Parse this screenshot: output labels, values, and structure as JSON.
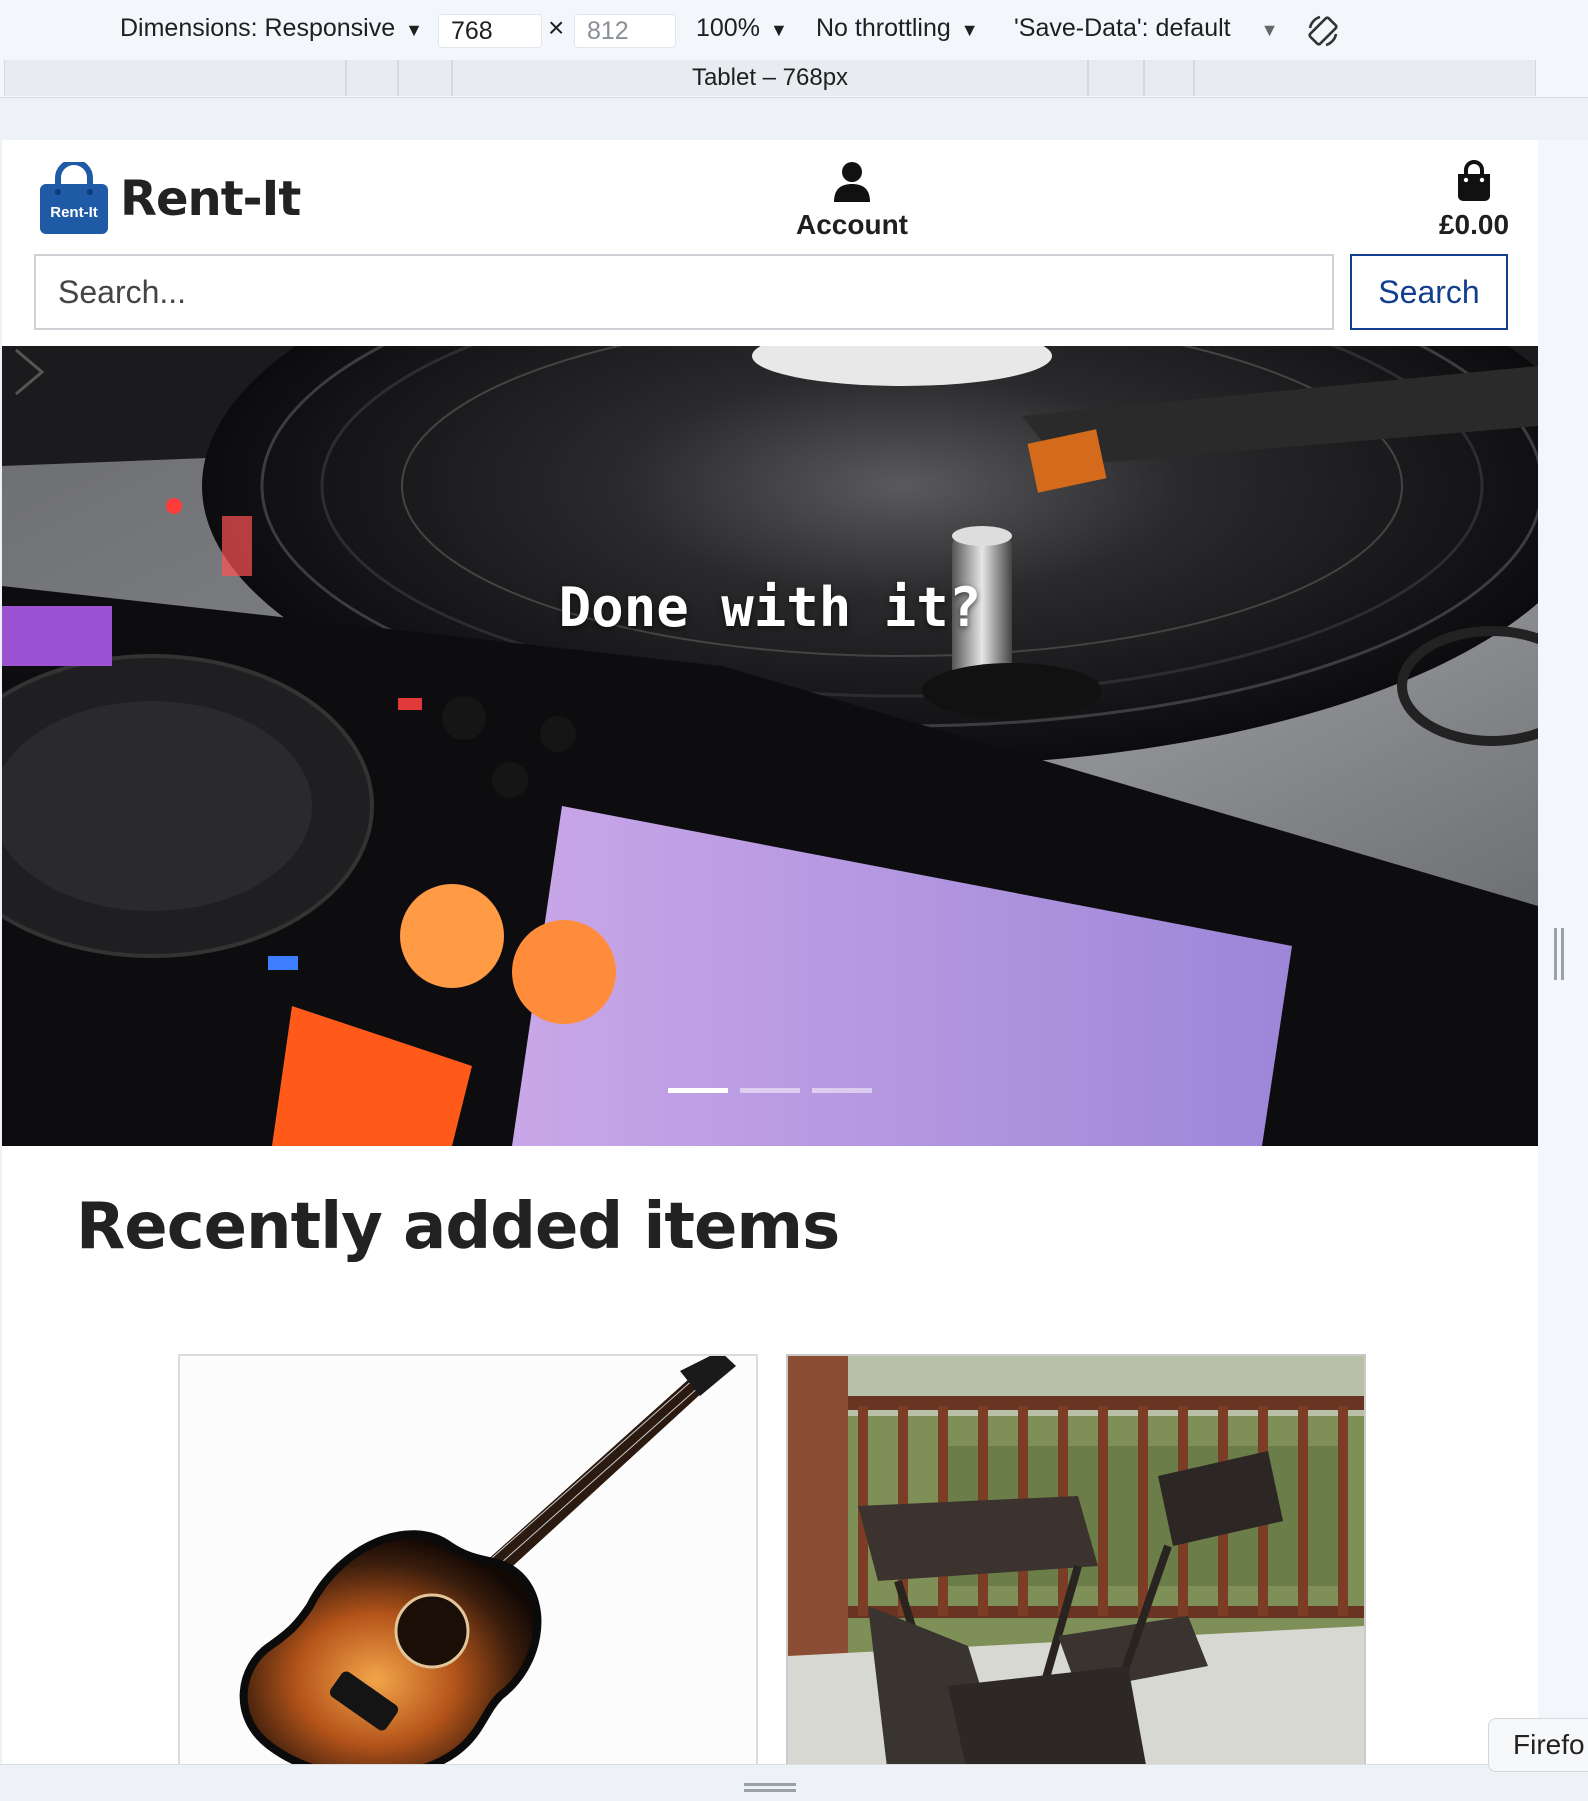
{
  "devtools": {
    "dimensions_label": "Dimensions: Responsive",
    "width_value": "768",
    "times_sign": "×",
    "height_value": "812",
    "zoom": "100%",
    "throttling": "No throttling",
    "save_data": "'Save-Data': default",
    "preset_label": "Tablet – 768px",
    "dropdown_arrow": "▼"
  },
  "header": {
    "brand_name": "Rent-It",
    "logo_text": "Rent-It",
    "account_label": "Account",
    "cart_total": "£0.00"
  },
  "search": {
    "placeholder": "Search...",
    "button_label": "Search"
  },
  "hero": {
    "caption": "Done with it?",
    "slides": 3,
    "active_slide": 1
  },
  "recent": {
    "title": "Recently added items"
  },
  "tooltip": {
    "text": "Firefo"
  },
  "colors": {
    "brand_blue": "#1f5aa6",
    "search_border": "#123f8f"
  }
}
